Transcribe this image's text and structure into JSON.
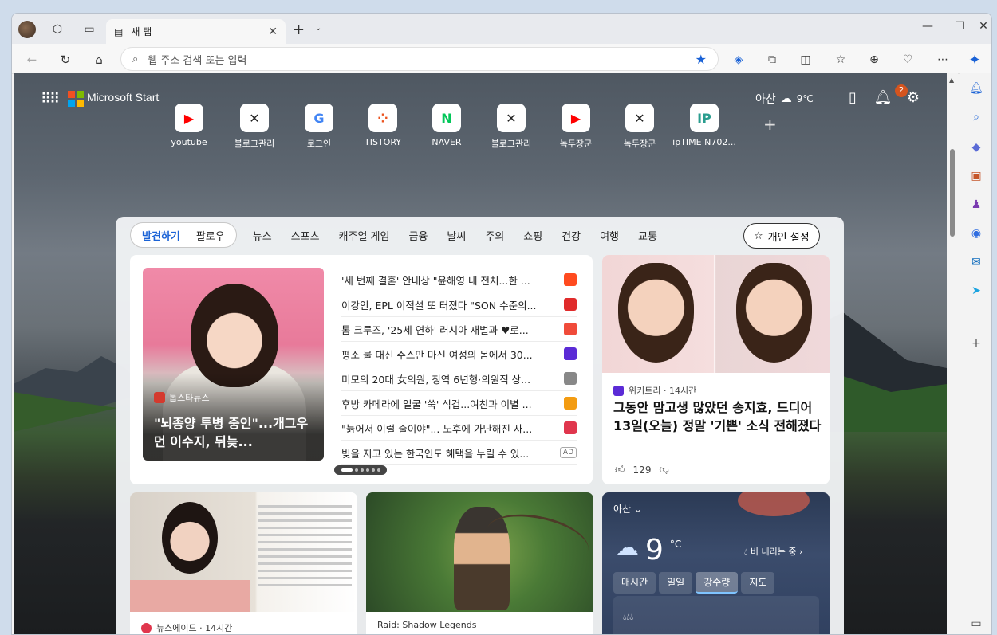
{
  "browser": {
    "tab_title": "새 탭",
    "address_placeholder": "웹 주소 검색 또는 입력"
  },
  "start": {
    "brand": "Microsoft Start",
    "location": "아산",
    "temperature": "9℃",
    "notifications": "2"
  },
  "quick_links": [
    {
      "label": "youtube",
      "glyph": "▶",
      "color": "#ff0000"
    },
    {
      "label": "블로그관리",
      "glyph": "✕",
      "color": "#222222"
    },
    {
      "label": "로그인",
      "glyph": "G",
      "color": "#4285f4"
    },
    {
      "label": "TISTORY",
      "glyph": "⁘",
      "color": "#eb531f"
    },
    {
      "label": "NAVER",
      "glyph": "N",
      "color": "#03c75a"
    },
    {
      "label": "블로그관리",
      "glyph": "✕",
      "color": "#222222"
    },
    {
      "label": "녹두장군",
      "glyph": "▶",
      "color": "#ff0000"
    },
    {
      "label": "녹두장군",
      "glyph": "✕",
      "color": "#222222"
    },
    {
      "label": "ipTIME N702...",
      "glyph": "IP",
      "color": "#2a9d8f"
    }
  ],
  "feed": {
    "segment": [
      "발견하기",
      "팔로우"
    ],
    "categories": [
      "뉴스",
      "스포츠",
      "캐주얼 게임",
      "금융",
      "날씨",
      "주의",
      "쇼핑",
      "건강",
      "여행",
      "교통"
    ],
    "personalize": "개인 설정",
    "hero": {
      "source": "톱스타뉴스",
      "title": "\"뇌종양 투병 중인\"...개그우먼 이수지, 뒤늦..."
    },
    "headlines": [
      {
        "text": "'세 번째 결혼' 안내상 \"윤해영 내 전처...한 ...",
        "color": "#ff4b1f"
      },
      {
        "text": "이강인, EPL 이적설 또 터졌다 \"SON 수준의...",
        "color": "#e02b2b"
      },
      {
        "text": "톰 크루즈, '25세 연하' 러시아 재벌과 ♥로...",
        "color": "#f04b3a"
      },
      {
        "text": "평소 물 대신 주스만 마신 여성의 몸에서 30...",
        "color": "#5b2bd6"
      },
      {
        "text": "미모의 20대 女의원, 징역 6년형·의원직 상...",
        "color": "#888888"
      },
      {
        "text": "후방 카메라에 얼굴 '쑥' 식겁...여친과 이별 ...",
        "color": "#f39c12"
      },
      {
        "text": "\"늙어서 이럴 줄이야\"... 노후에 가난해진 사...",
        "color": "#e0364d"
      },
      {
        "text": "빚을 지고 있는 한국인도 혜택을 누릴 수 있...",
        "color": "",
        "ad": "AD"
      }
    ],
    "side_story": {
      "source": "위키트리 · 14시간",
      "title": "그동안 맘고생 많았던 송지효, 드디어 13일(오늘) 정말 '기쁜' 소식 전해졌다",
      "likes": "129"
    },
    "card2_source": "뉴스에이드 · 14시간",
    "card3_source": "Raid: Shadow Legends",
    "weather": {
      "location": "아산",
      "temp": "9",
      "unit": "°C",
      "rain_note": "비 내리는 중",
      "tabs": [
        "매시간",
        "일일",
        "강수량",
        "지도"
      ]
    }
  }
}
